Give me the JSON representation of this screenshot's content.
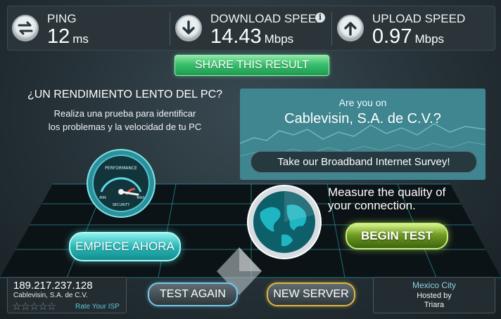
{
  "stats": {
    "ping": {
      "label": "PING",
      "value": "12",
      "unit": "ms",
      "icon": "ping-arrows-icon"
    },
    "download": {
      "label": "DOWNLOAD SPEED",
      "value": "14.43",
      "unit": "Mbps",
      "icon": "download-arrow-icon",
      "info": "i"
    },
    "upload": {
      "label": "UPLOAD SPEED",
      "value": "0.97",
      "unit": "Mbps",
      "icon": "upload-arrow-icon"
    }
  },
  "share_label": "SHARE THIS RESULT",
  "promo_left": {
    "title": "¿UN RENDIMIENTO LENTO DEL PC?",
    "subtitle_line1": "Realiza una prueba para identificar",
    "subtitle_line2": "los problemas y la velocidad de tu PC",
    "gauge_top": "PERFORMANCE",
    "gauge_min": "MIN",
    "gauge_max": "MAX",
    "gauge_bottom": "SECURITY",
    "button": "EMPIECE AHORA"
  },
  "survey": {
    "question": "Are you on",
    "isp": "Cablevisin, S.A. de C.V.?",
    "button": "Take our Broadband Internet Survey!"
  },
  "measure": {
    "line1": "Measure the quality of",
    "line2": "your connection.",
    "button": "BEGIN TEST"
  },
  "client": {
    "ip": "189.217.237.128",
    "isp": "Cablevisin, S.A. de C.V.",
    "stars": "☆☆☆☆☆",
    "rate": "Rate Your ISP"
  },
  "actions": {
    "test_again": "TEST AGAIN",
    "new_server": "NEW SERVER"
  },
  "server": {
    "city": "Mexico City",
    "hosted_by": "Hosted by",
    "host": "Triara"
  },
  "colors": {
    "accent_green": "#38c06b",
    "accent_teal": "#2ab8b7",
    "accent_lime": "#6f9b22",
    "accent_gold": "#e0b642",
    "accent_blue": "#77c8e8"
  }
}
